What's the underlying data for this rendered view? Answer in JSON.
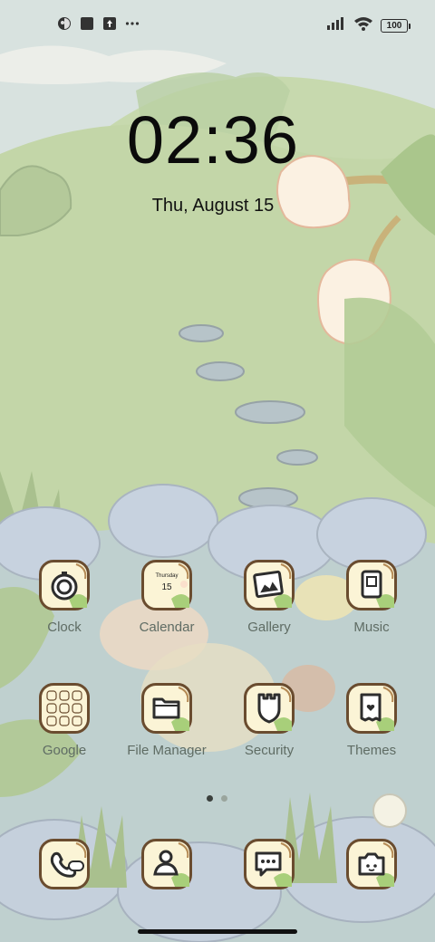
{
  "status_bar": {
    "left_icons": [
      "app-notification-icon",
      "square-notification-icon",
      "upload-icon",
      "more-dots-icon"
    ],
    "right_icons": [
      "signal-icon",
      "wifi-icon",
      "battery-icon"
    ],
    "battery_level": "100"
  },
  "lock_clock": {
    "time": "02:36",
    "date": "Thu, August 15"
  },
  "apps": {
    "row1": [
      {
        "label": "Clock",
        "icon": "clock-icon"
      },
      {
        "label": "Calendar",
        "icon": "calendar-icon",
        "weekday": "Thursday",
        "day": "15"
      },
      {
        "label": "Gallery",
        "icon": "gallery-icon"
      },
      {
        "label": "Music",
        "icon": "music-icon"
      }
    ],
    "row2": [
      {
        "label": "Google",
        "icon": "google-folder-icon"
      },
      {
        "label": "File Manager",
        "icon": "folder-icon"
      },
      {
        "label": "Security",
        "icon": "shield-icon"
      },
      {
        "label": "Themes",
        "icon": "themes-icon"
      }
    ],
    "dock": [
      {
        "icon": "phone-icon"
      },
      {
        "icon": "contacts-icon"
      },
      {
        "icon": "messages-icon"
      },
      {
        "icon": "camera-icon"
      }
    ]
  },
  "page_indicator": {
    "pages": 2,
    "current": 1
  },
  "colors": {
    "icon_bg": "#fbf4d6",
    "icon_border": "#6a4c2f",
    "label": "#5f6c64",
    "dot_active": "#3a3f3c",
    "dot_inactive": "#9aa59d"
  }
}
